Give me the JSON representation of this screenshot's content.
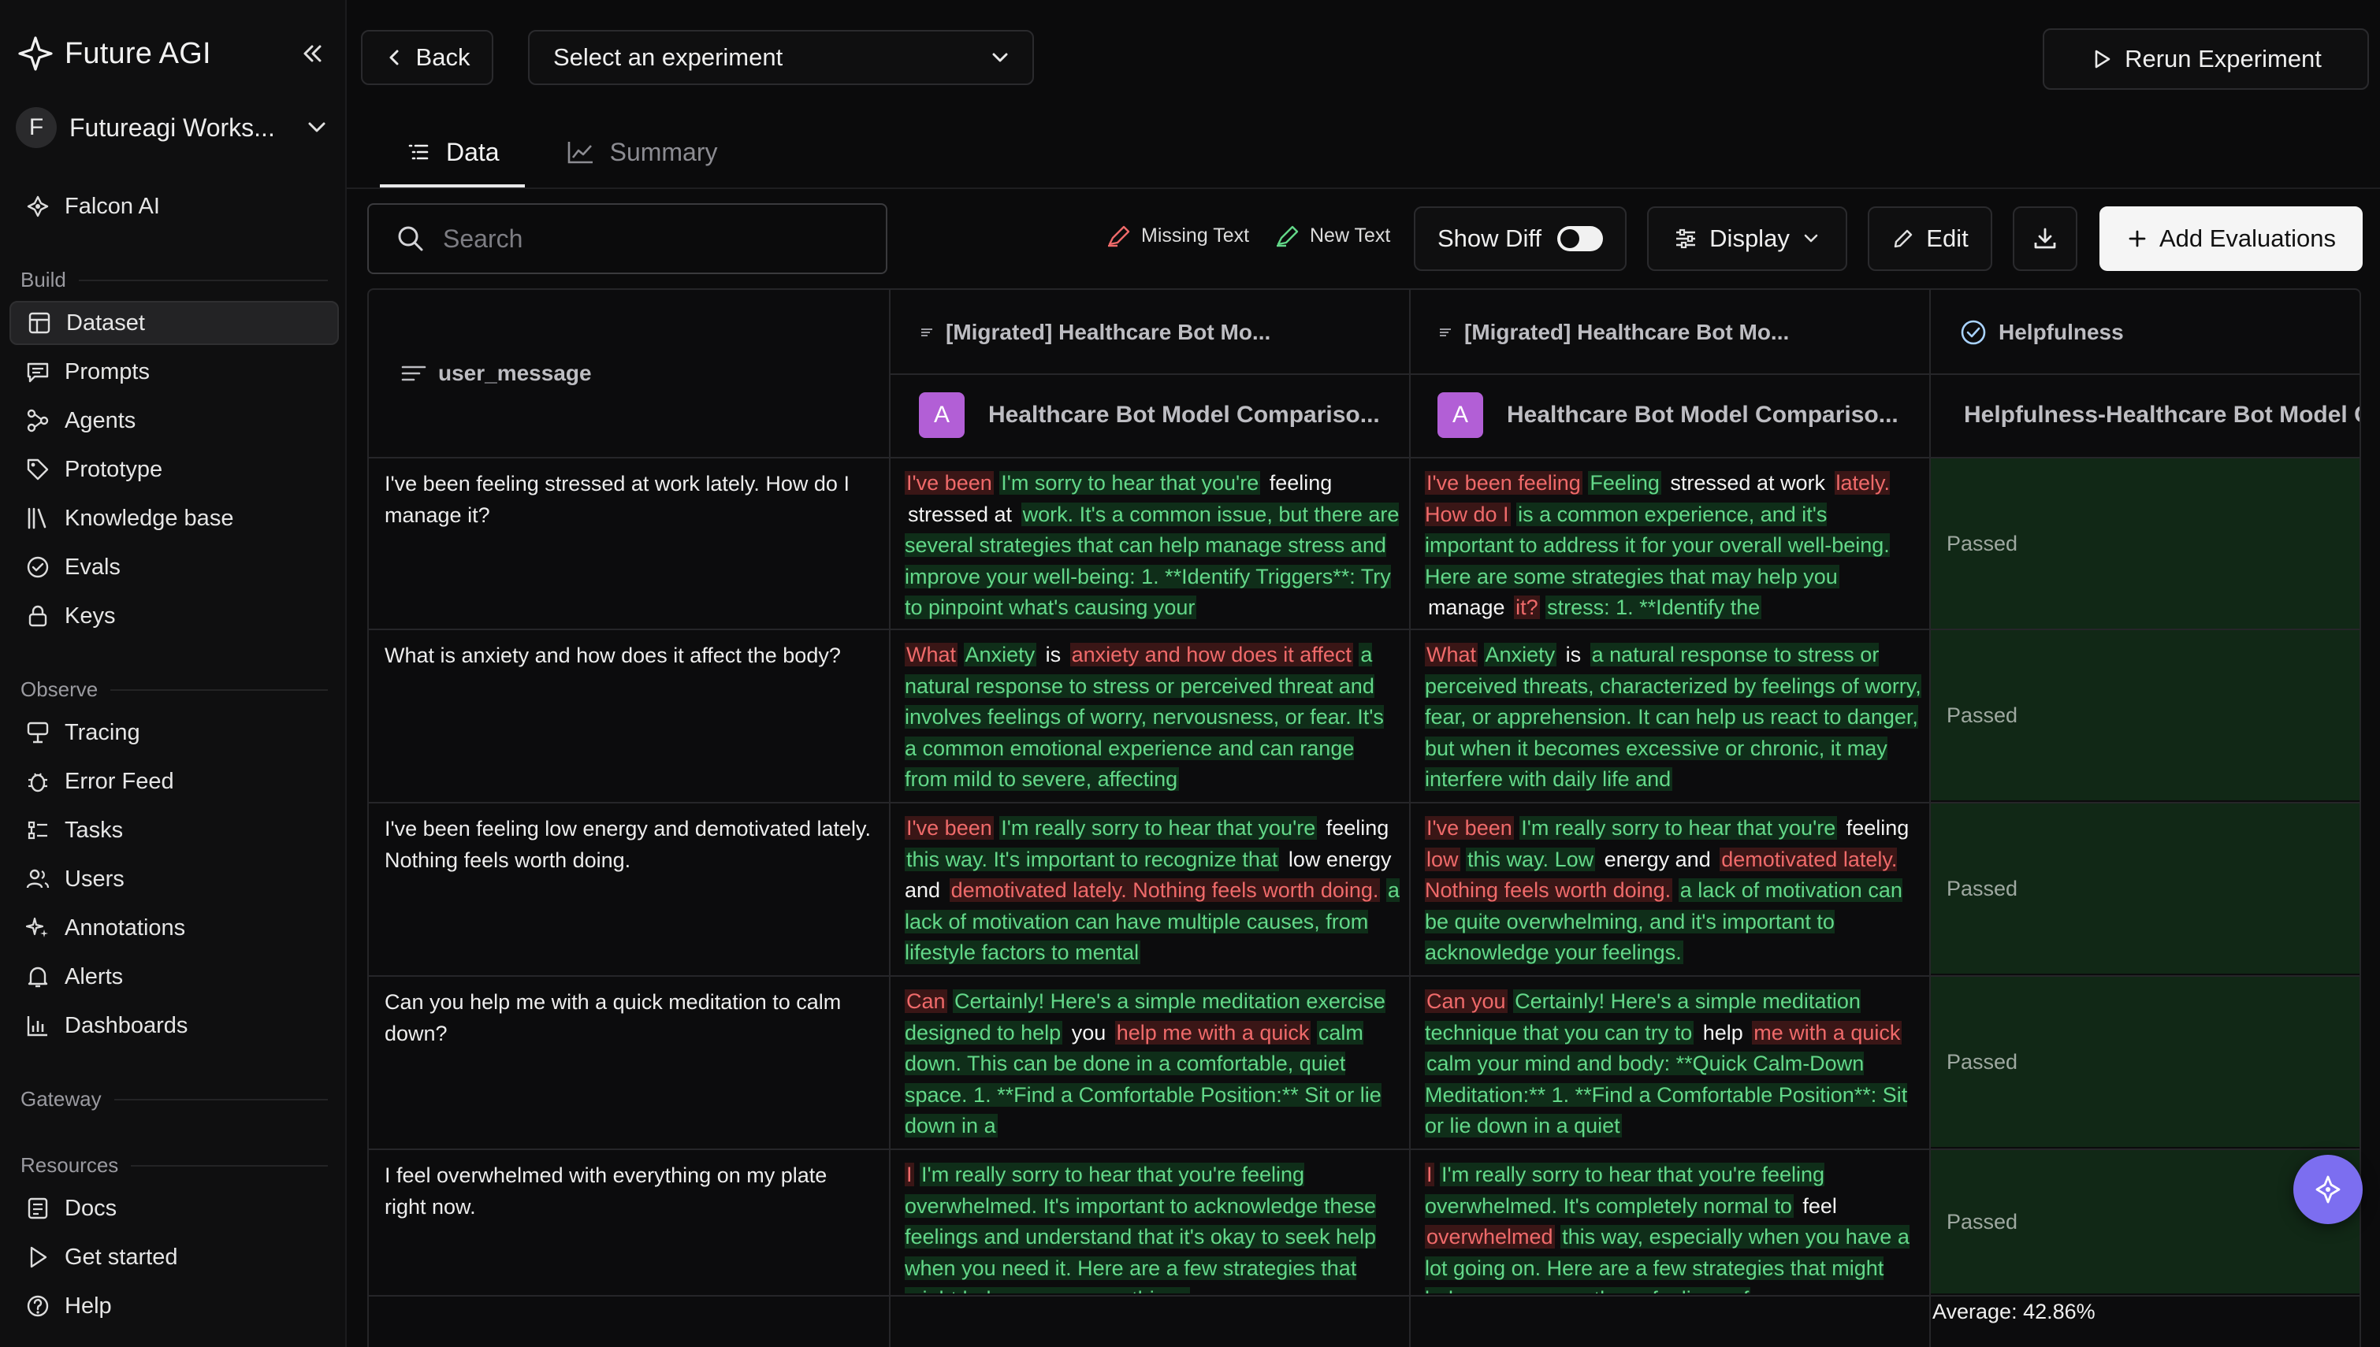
{
  "brand": {
    "name": "Future AGI"
  },
  "workspace": {
    "initial": "F",
    "name": "Futureagi Works..."
  },
  "nav": {
    "falcon": "Falcon AI",
    "build_label": "Build",
    "build": [
      "Dataset",
      "Prompts",
      "Agents",
      "Prototype",
      "Knowledge base",
      "Evals",
      "Keys"
    ],
    "observe_label": "Observe",
    "observe": [
      "Tracing",
      "Error Feed",
      "Tasks",
      "Users",
      "Annotations",
      "Alerts",
      "Dashboards"
    ],
    "gateway_label": "Gateway",
    "resources_label": "Resources",
    "resources": [
      "Docs",
      "Get started",
      "Help"
    ],
    "active": "Dataset"
  },
  "topbar": {
    "back": "Back",
    "experiment_select": "Select an experiment",
    "rerun": "Rerun Experiment"
  },
  "tabs": [
    "Data",
    "Summary"
  ],
  "toolbar": {
    "search_placeholder": "Search",
    "missing_text": "Missing Text",
    "new_text": "New Text",
    "show_diff": "Show Diff",
    "display": "Display",
    "edit": "Edit",
    "add_evaluations": "Add Evaluations"
  },
  "table": {
    "headers": {
      "user_message": "user_message",
      "model_a": "[Migrated] Healthcare Bot Mo...",
      "model_b": "[Migrated] Healthcare Bot Mo...",
      "eval": "Helpfulness"
    },
    "sub_headers": {
      "model_a": "Healthcare Bot Model Compariso...",
      "model_b": "Healthcare Bot Model Compariso...",
      "model_badge": "A",
      "eval": "Helpfulness-Healthcare Bot Model C"
    },
    "rows": [
      {
        "user_message": "I've been feeling stressed at work lately. How do I manage it?",
        "a": [
          [
            "m",
            "I've been"
          ],
          [
            "n",
            "I'm sorry to hear that you're"
          ],
          [
            "s",
            "feeling"
          ],
          [
            "s",
            "stressed at"
          ],
          [
            "n",
            "work. It's a common issue, but there are several strategies that can help manage stress and improve your well-being: 1. **Identify Triggers**: Try to pinpoint what's causing your"
          ]
        ],
        "b": [
          [
            "m",
            "I've been feeling"
          ],
          [
            "n",
            "Feeling"
          ],
          [
            "s",
            "stressed at work"
          ],
          [
            "m",
            "lately. How do I"
          ],
          [
            "n",
            "is a common experience, and it's important to address it for your overall well-being. Here are some strategies that may help you"
          ],
          [
            "s",
            "manage"
          ],
          [
            "m",
            "it?"
          ],
          [
            "n",
            "stress: 1. **Identify the"
          ]
        ],
        "eval": "Passed"
      },
      {
        "user_message": "What is anxiety and how does it affect the body?",
        "a": [
          [
            "m",
            "What"
          ],
          [
            "n",
            "Anxiety"
          ],
          [
            "s",
            "is"
          ],
          [
            "m",
            "anxiety and how does it affect"
          ],
          [
            "n",
            "a natural response to stress or perceived threat and involves feelings of worry, nervousness, or fear. It's a common emotional experience and can range from mild to severe, affecting"
          ]
        ],
        "b": [
          [
            "m",
            "What"
          ],
          [
            "n",
            "Anxiety"
          ],
          [
            "s",
            "is"
          ],
          [
            "n",
            "a natural response to stress or perceived threats, characterized by feelings of worry, fear, or apprehension. It can help us react to danger, but when it becomes excessive or chronic, it may interfere with daily life and"
          ]
        ],
        "eval": "Passed"
      },
      {
        "user_message": "I've been feeling low energy and demotivated lately. Nothing feels worth doing.",
        "a": [
          [
            "m",
            "I've been"
          ],
          [
            "n",
            "I'm really sorry to hear that you're"
          ],
          [
            "s",
            "feeling"
          ],
          [
            "n",
            "this way. It's important to recognize that"
          ],
          [
            "s",
            "low energy and"
          ],
          [
            "m",
            "demotivated lately. Nothing feels worth doing."
          ],
          [
            "n",
            "a lack of motivation can have multiple causes, from lifestyle factors to mental"
          ]
        ],
        "b": [
          [
            "m",
            "I've been"
          ],
          [
            "n",
            "I'm really sorry to hear that you're"
          ],
          [
            "s",
            "feeling"
          ],
          [
            "m",
            "low"
          ],
          [
            "n",
            "this way. Low"
          ],
          [
            "s",
            "energy and"
          ],
          [
            "m",
            "demotivated lately. Nothing feels worth doing."
          ],
          [
            "n",
            "a lack of motivation can be quite overwhelming, and it's important to acknowledge your feelings."
          ]
        ],
        "eval": "Passed"
      },
      {
        "user_message": "Can you help me with a quick meditation to calm down?",
        "a": [
          [
            "m",
            "Can"
          ],
          [
            "n",
            "Certainly! Here's a simple meditation exercise designed to help"
          ],
          [
            "s",
            "you"
          ],
          [
            "m",
            "help me with a quick"
          ],
          [
            "n",
            "calm down. This can be done in a comfortable, quiet space. 1. **Find a Comfortable Position:** Sit or lie down in a"
          ]
        ],
        "b": [
          [
            "m",
            "Can you"
          ],
          [
            "n",
            "Certainly! Here's a simple meditation technique that you can try to"
          ],
          [
            "s",
            "help"
          ],
          [
            "m",
            "me with a quick"
          ],
          [
            "n",
            "calm your mind and body: **Quick Calm-Down Meditation:** 1. **Find a Comfortable Position**: Sit or lie down in a quiet"
          ]
        ],
        "eval": "Passed"
      },
      {
        "user_message": "I feel overwhelmed with everything on my plate right now.",
        "a": [
          [
            "m",
            "I"
          ],
          [
            "n",
            "I'm really sorry to hear that you're feeling overwhelmed. It's important to acknowledge these feelings and understand that it's okay to seek help when you need it. Here are a few strategies that might help you manage things"
          ]
        ],
        "b": [
          [
            "m",
            "I"
          ],
          [
            "n",
            "I'm really sorry to hear that you're feeling overwhelmed. It's completely normal to"
          ],
          [
            "s",
            "feel"
          ],
          [
            "m",
            "overwhelmed"
          ],
          [
            "n",
            "this way, especially when you have a lot going on. Here are a few strategies that might help you manage these feelings of"
          ]
        ],
        "eval": "Passed"
      }
    ],
    "average": "Average: 42.86%"
  },
  "colors": {
    "new_text": "#63d889",
    "missing_text": "#ef6a6a",
    "pass_bg": "#112816",
    "badge": "#b25fd6",
    "fab": "#7c6ef0"
  }
}
